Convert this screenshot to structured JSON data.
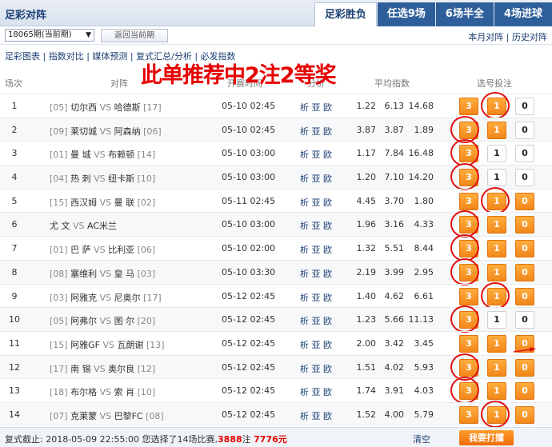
{
  "header": {
    "title": "足彩对阵",
    "tabs": [
      "足彩胜负",
      "任选9场",
      "6场半全",
      "4场进球"
    ],
    "active_tab": 0
  },
  "toolbar": {
    "period_value": "18065期(当前期)",
    "back_button": "返回当前期",
    "link_month": "本月对阵",
    "link_separator": " | ",
    "link_history": "历史对阵"
  },
  "subnav": {
    "items": [
      "足彩图表",
      "指数对比",
      "媒体预测",
      "复式汇总/分析",
      "必发指数"
    ],
    "separator": " | "
  },
  "overlay_text": "此单推荐中2注2等奖",
  "table": {
    "headers": {
      "no": "场次",
      "match": "对阵",
      "time": "开赛时间",
      "analysis": "分析",
      "odds": "平均指数",
      "pick": "选号投注"
    },
    "odds_label": "析 亚 欧",
    "vs": "VS",
    "rows": [
      {
        "no": "1",
        "home_rank": "[05]",
        "home": "切尔西",
        "away": "哈德斯",
        "away_rank": "[17]",
        "time": "05-10 02:45",
        "o1": "1.22",
        "o2": "6.13",
        "o3": "14.68",
        "picks": [
          true,
          true,
          false
        ],
        "circled": [
          "1"
        ]
      },
      {
        "no": "2",
        "home_rank": "[09]",
        "home": "莱切城",
        "away": "阿森纳",
        "away_rank": "[06]",
        "time": "05-10 02:45",
        "o1": "3.87",
        "o2": "3.87",
        "o3": "1.89",
        "picks": [
          true,
          true,
          false
        ],
        "circled": [
          "3"
        ]
      },
      {
        "no": "3",
        "home_rank": "[01]",
        "home": "曼 城",
        "away": "布赖顿",
        "away_rank": "[14]",
        "time": "05-10 03:00",
        "o1": "1.17",
        "o2": "7.84",
        "o3": "16.48",
        "picks": [
          true,
          false,
          false
        ],
        "circled": [
          "3"
        ]
      },
      {
        "no": "4",
        "home_rank": "[04]",
        "home": "热 刺",
        "away": "纽卡斯",
        "away_rank": "[10]",
        "time": "05-10 03:00",
        "o1": "1.20",
        "o2": "7.10",
        "o3": "14.20",
        "picks": [
          true,
          false,
          false
        ],
        "circled": [
          "3"
        ]
      },
      {
        "no": "5",
        "home_rank": "[15]",
        "home": "西汉姆",
        "away": "曼 联",
        "away_rank": "[02]",
        "time": "05-11 02:45",
        "o1": "4.45",
        "o2": "3.70",
        "o3": "1.80",
        "picks": [
          true,
          true,
          true
        ],
        "circled": [
          "1"
        ]
      },
      {
        "no": "6",
        "home_rank": "",
        "home": "尤 文",
        "away": "AC米兰",
        "away_rank": "",
        "time": "05-10 03:00",
        "o1": "1.96",
        "o2": "3.16",
        "o3": "4.33",
        "picks": [
          true,
          true,
          true
        ],
        "circled": [
          "3"
        ]
      },
      {
        "no": "7",
        "home_rank": "[01]",
        "home": "巴 萨",
        "away": "比利亚",
        "away_rank": "[06]",
        "time": "05-10 02:00",
        "o1": "1.32",
        "o2": "5.51",
        "o3": "8.44",
        "picks": [
          true,
          true,
          true
        ],
        "circled": [
          "3"
        ]
      },
      {
        "no": "8",
        "home_rank": "[08]",
        "home": "塞维利",
        "away": "皇 马",
        "away_rank": "[03]",
        "time": "05-10 03:30",
        "o1": "2.19",
        "o2": "3.99",
        "o3": "2.95",
        "picks": [
          true,
          true,
          true
        ],
        "circled": [
          "3"
        ]
      },
      {
        "no": "9",
        "home_rank": "[03]",
        "home": "阿雅克",
        "away": "尼奥尔",
        "away_rank": "[17]",
        "time": "05-12 02:45",
        "o1": "1.40",
        "o2": "4.62",
        "o3": "6.61",
        "picks": [
          true,
          true,
          true
        ],
        "circled": [
          "1"
        ]
      },
      {
        "no": "10",
        "home_rank": "[05]",
        "home": "阿弗尔",
        "away": "图 尔",
        "away_rank": "[20]",
        "time": "05-12 02:45",
        "o1": "1.23",
        "o2": "5.66",
        "o3": "11.13",
        "picks": [
          true,
          false,
          false
        ],
        "circled": [
          "3"
        ]
      },
      {
        "no": "11",
        "home_rank": "[15]",
        "home": "阿雅GF",
        "away": "瓦朗谢",
        "away_rank": "[13]",
        "time": "05-12 02:45",
        "o1": "2.00",
        "o2": "3.42",
        "o3": "3.45",
        "picks": [
          true,
          true,
          true
        ],
        "circled": []
      },
      {
        "no": "12",
        "home_rank": "[17]",
        "home": "南 锡",
        "away": "奥尔良",
        "away_rank": "[12]",
        "time": "05-12 02:45",
        "o1": "1.51",
        "o2": "4.02",
        "o3": "5.93",
        "picks": [
          true,
          true,
          true
        ],
        "circled": [
          "3"
        ]
      },
      {
        "no": "13",
        "home_rank": "[18]",
        "home": "布尔格",
        "away": "索 肖",
        "away_rank": "[10]",
        "time": "05-12 02:45",
        "o1": "1.74",
        "o2": "3.91",
        "o3": "4.03",
        "picks": [
          true,
          true,
          true
        ],
        "circled": [
          "3"
        ]
      },
      {
        "no": "14",
        "home_rank": "[07]",
        "home": "克莱蒙",
        "away": "巴黎FC",
        "away_rank": "[08]",
        "time": "05-12 02:45",
        "o1": "1.52",
        "o2": "4.00",
        "o3": "5.79",
        "picks": [
          true,
          true,
          true
        ],
        "circled": [
          "1"
        ]
      }
    ]
  },
  "footer": {
    "deadline_label": "复式截止: 2018-05-09 22:55:00 您选择了14场比赛,",
    "bets": "3888",
    "bets_unit": "注",
    "amount": "7776元",
    "clear": "清空",
    "buy": "我要打擂"
  },
  "colors": {
    "accent": "#2f5f9b",
    "highlight": "#e60000",
    "pick_on": "#f2861a"
  }
}
